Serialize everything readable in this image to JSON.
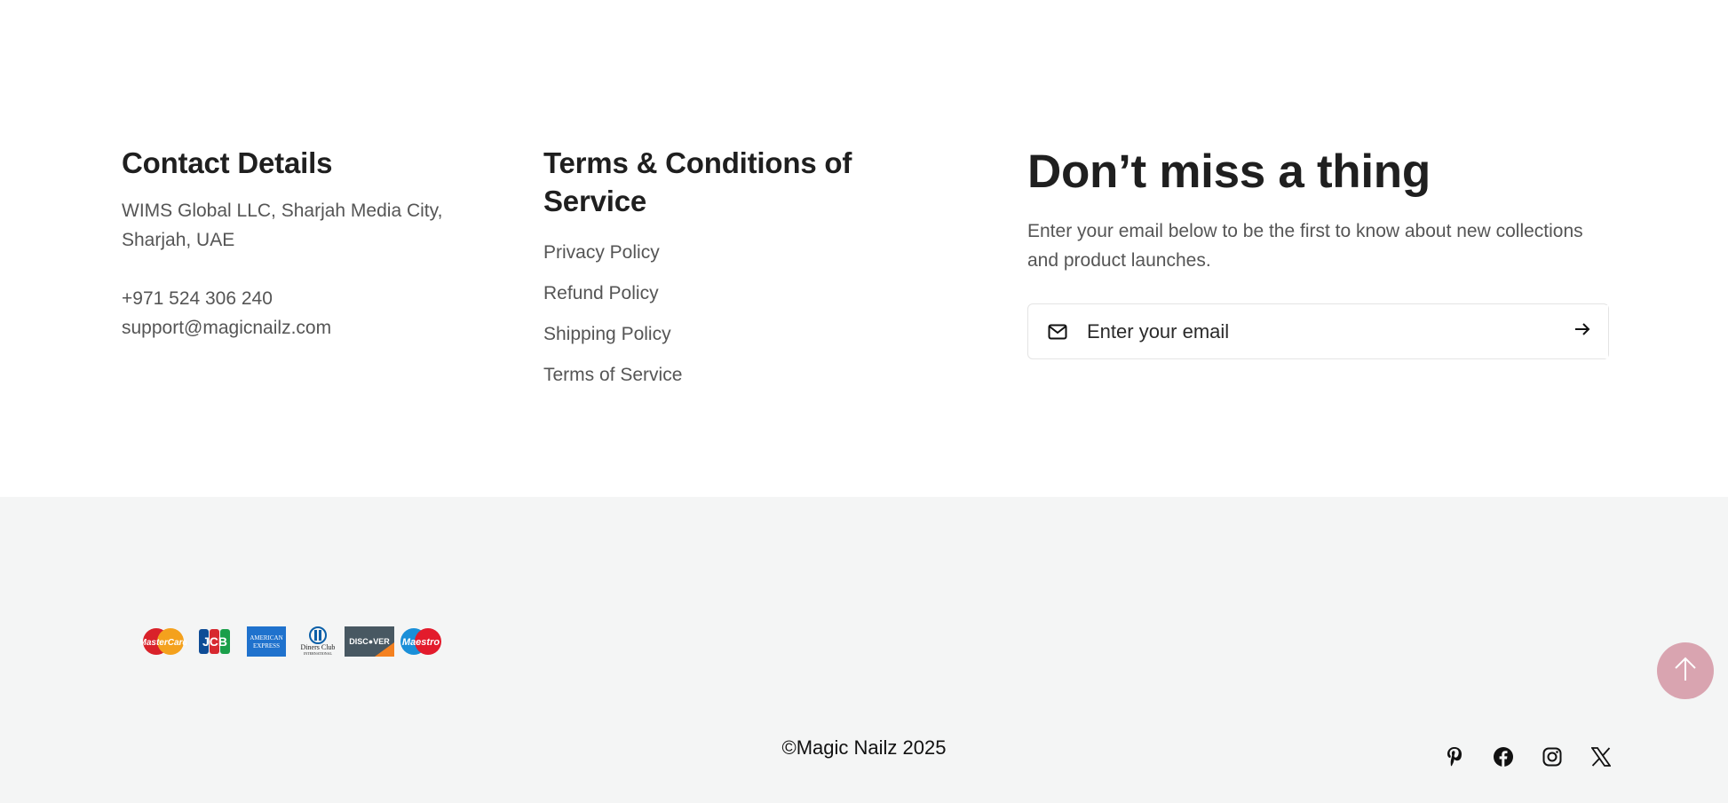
{
  "contact": {
    "heading": "Contact Details",
    "address_line1": "WIMS Global LLC, Sharjah Media City,",
    "address_line2": "Sharjah, UAE",
    "phone": "+971 524 306 240",
    "email": "support@magicnailz.com"
  },
  "terms": {
    "heading_line1": "Terms & Conditions of",
    "heading_line2": "Service",
    "links": [
      {
        "label": "Privacy Policy"
      },
      {
        "label": "Refund Policy"
      },
      {
        "label": "Shipping Policy"
      },
      {
        "label": "Terms of Service"
      }
    ]
  },
  "newsletter": {
    "title": "Don’t miss a thing",
    "text_line1": "Enter your email below to be the first to know about new collections",
    "text_line2": "and product launches.",
    "placeholder": "Enter your email",
    "icon": "mail-icon",
    "submit_icon": "arrow-right-icon"
  },
  "payments": [
    {
      "name": "MasterCard",
      "icon": "mastercard-icon"
    },
    {
      "name": "JCB",
      "icon": "jcb-icon"
    },
    {
      "name": "American Express",
      "icon": "amex-icon"
    },
    {
      "name": "Diners Club International",
      "icon": "diners-club-icon"
    },
    {
      "name": "DISCOVER",
      "icon": "discover-icon"
    },
    {
      "name": "Maestro",
      "icon": "maestro-icon"
    }
  ],
  "copyright": "©Magic Nailz 2025",
  "social": [
    {
      "icon": "pinterest-icon"
    },
    {
      "icon": "facebook-icon"
    },
    {
      "icon": "instagram-icon"
    },
    {
      "icon": "x-twitter-icon"
    }
  ],
  "colors": {
    "footer_bg": "#f4f5f5",
    "scroll_top_bg": "#d9a4b0",
    "text": "#1f1f1f",
    "muted": "#555555"
  }
}
